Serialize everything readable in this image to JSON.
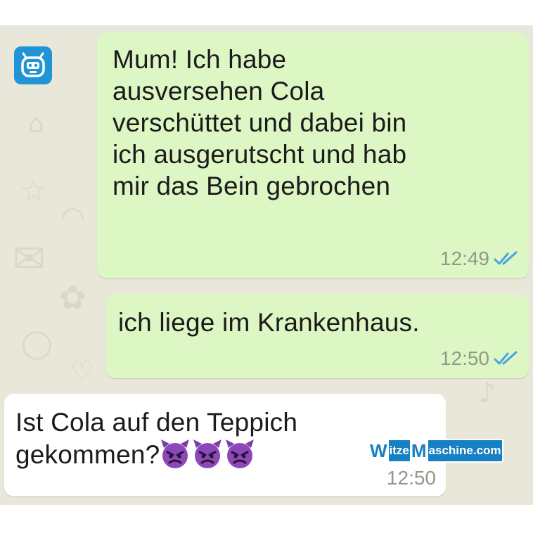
{
  "colors": {
    "chat_background": "#e9e6da",
    "outgoing_bubble": "#dcf6c4",
    "incoming_bubble": "#ffffff",
    "read_ticks": "#4aa3df",
    "brand_blue": "#1780c4"
  },
  "messages": [
    {
      "direction": "outgoing",
      "lines": [
        "Mum! Ich habe",
        "ausversehen Cola",
        "verschüttet und dabei bin",
        "ich ausgerutscht und hab",
        "mir das Bein gebrochen"
      ],
      "time": "12:49",
      "status_icon": "double-check-icon"
    },
    {
      "direction": "outgoing",
      "lines": [
        "ich liege im Krankenhaus."
      ],
      "time": "12:50",
      "status_icon": "double-check-icon"
    },
    {
      "direction": "incoming",
      "lines": [
        "Ist Cola auf den Teppich",
        "gekommen?"
      ],
      "emoji": [
        "angry-devil-emoji",
        "angry-devil-emoji",
        "angry-devil-emoji"
      ],
      "time": "12:50"
    }
  ],
  "watermark": {
    "part1_cap": "W",
    "part1_rest": "itze",
    "part2_cap": "M",
    "part2_rest": "aschine.com"
  },
  "logo_icon": "robot-icon"
}
